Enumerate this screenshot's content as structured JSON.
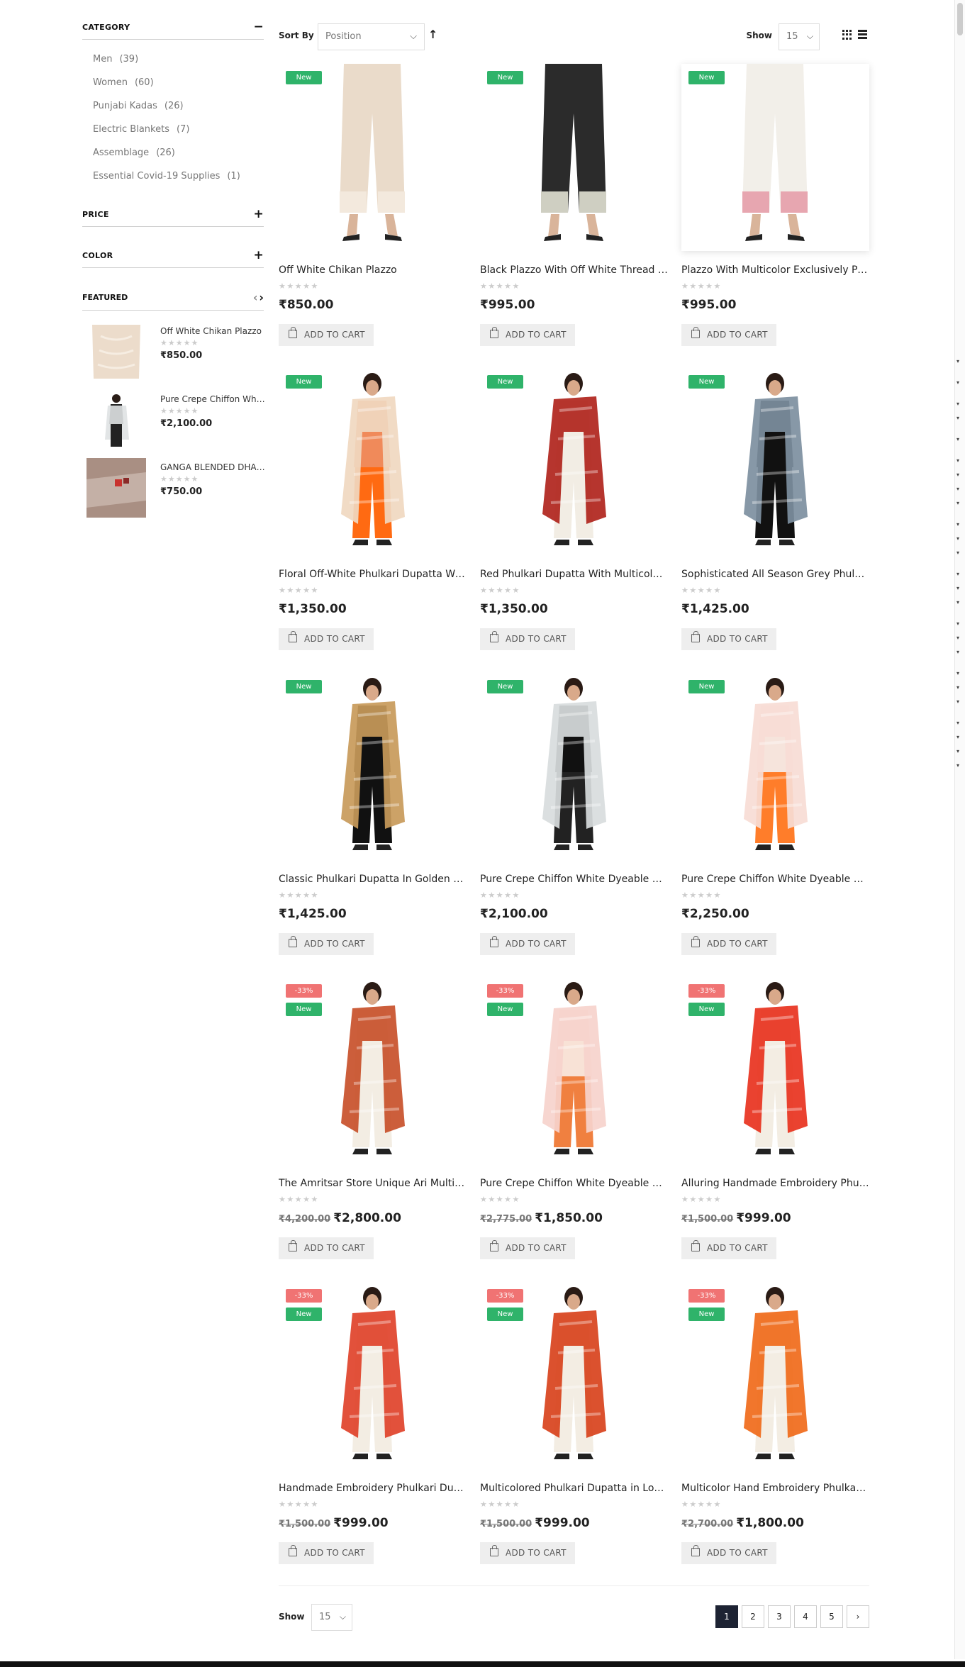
{
  "sidebar": {
    "category_title": "CATEGORY",
    "category_toggle": "−",
    "categories": [
      {
        "label": "Men",
        "count": "(39)"
      },
      {
        "label": "Women",
        "count": "(60)"
      },
      {
        "label": "Punjabi Kadas",
        "count": "(26)"
      },
      {
        "label": "Electric Blankets",
        "count": "(7)"
      },
      {
        "label": "Assemblage",
        "count": "(26)"
      },
      {
        "label": "Essential Covid-19 Supplies",
        "count": "(1)"
      }
    ],
    "price_title": "PRICE",
    "color_title": "COLOR",
    "expand_toggle": "+",
    "featured_title": "FEATURED",
    "featured": [
      {
        "name": "Off White Chikan Plazzo",
        "stars": "★★★★★",
        "price": "₹850.00"
      },
      {
        "name": "Pure Crepe Chiffon White Dyeable Dupatta",
        "stars": "★★★★★",
        "price": "₹2,100.00"
      },
      {
        "name": "GANGA BLENDED DHARIWAL SHAWL",
        "stars": "★★★★★",
        "price": "₹750.00"
      }
    ]
  },
  "toolbar": {
    "sort_label": "Sort By",
    "sort_value": "Position",
    "sort_dir": "🠕",
    "show_label": "Show",
    "show_value": "15"
  },
  "products": [
    {
      "name": "Off White Chikan Plazzo",
      "price": "₹850.00",
      "old_price": "",
      "new": "New",
      "discount": "",
      "stars": "★★★★★",
      "cart": "ADD TO CART"
    },
    {
      "name": "Black Plazzo With Off White Thread Work",
      "price": "₹995.00",
      "old_price": "",
      "new": "New",
      "discount": "",
      "stars": "★★★★★",
      "cart": "ADD TO CART"
    },
    {
      "name": "Plazzo With Multicolor Exclusively Printed",
      "price": "₹995.00",
      "old_price": "",
      "new": "New",
      "discount": "",
      "stars": "★★★★★",
      "cart": "ADD TO CART"
    },
    {
      "name": "Floral Off-White Phulkari Dupatta With Thread Work",
      "price": "₹1,350.00",
      "old_price": "",
      "new": "New",
      "discount": "",
      "stars": "★★★★★",
      "cart": "ADD TO CART"
    },
    {
      "name": "Red Phulkari Dupatta With Multicolor Embroidery",
      "price": "₹1,350.00",
      "old_price": "",
      "new": "New",
      "discount": "",
      "stars": "★★★★★",
      "cart": "ADD TO CART"
    },
    {
      "name": "Sophisticated All Season Grey Phulkari Dupatta",
      "price": "₹1,425.00",
      "old_price": "",
      "new": "New",
      "discount": "",
      "stars": "★★★★★",
      "cart": "ADD TO CART"
    },
    {
      "name": "Classic Phulkari Dupatta In Golden Embroidery",
      "price": "₹1,425.00",
      "old_price": "",
      "new": "New",
      "discount": "",
      "stars": "★★★★★",
      "cart": "ADD TO CART"
    },
    {
      "name": "Pure Crepe Chiffon White Dyeable Dupatta",
      "price": "₹2,100.00",
      "old_price": "",
      "new": "New",
      "discount": "",
      "stars": "★★★★★",
      "cart": "ADD TO CART"
    },
    {
      "name": "Pure Crepe Chiffon White Dyeable Dupatta",
      "price": "₹2,250.00",
      "old_price": "",
      "new": "New",
      "discount": "",
      "stars": "★★★★★",
      "cart": "ADD TO CART"
    },
    {
      "name": "The Amritsar Store Unique Ari Multicolor Dupatta",
      "price": "₹2,800.00",
      "old_price": "₹4,200.00",
      "new": "New",
      "discount": "-33%",
      "stars": "★★★★★",
      "cart": "ADD TO CART"
    },
    {
      "name": "Pure Crepe Chiffon White Dyeable Dupatta",
      "price": "₹1,850.00",
      "old_price": "₹2,775.00",
      "new": "New",
      "discount": "-33%",
      "stars": "★★★★★",
      "cart": "ADD TO CART"
    },
    {
      "name": "Alluring Handmade Embroidery Phulkari Dupatta",
      "price": "₹999.00",
      "old_price": "₹1,500.00",
      "new": "New",
      "discount": "-33%",
      "stars": "★★★★★",
      "cart": "ADD TO CART"
    },
    {
      "name": "Handmade Embroidery Phulkari Dupatta",
      "price": "₹999.00",
      "old_price": "₹1,500.00",
      "new": "New",
      "discount": "-33%",
      "stars": "★★★★★",
      "cart": "ADD TO CART"
    },
    {
      "name": "Multicolored Phulkari Dupatta in Lovely Colors",
      "price": "₹999.00",
      "old_price": "₹1,500.00",
      "new": "New",
      "discount": "-33%",
      "stars": "★★★★★",
      "cart": "ADD TO CART"
    },
    {
      "name": "Multicolor Hand Embroidery Phulkari Dupatta",
      "price": "₹1,800.00",
      "old_price": "₹2,700.00",
      "new": "New",
      "discount": "-33%",
      "stars": "★★★★★",
      "cart": "ADD TO CART"
    }
  ],
  "bottom": {
    "show_label": "Show",
    "show_value": "15",
    "pages": [
      "1",
      "2",
      "3",
      "4",
      "5"
    ],
    "next": "›"
  },
  "colors": {
    "new_badge": "#2fb36a",
    "discount_badge": "#f07373",
    "active_page": "#1d2333"
  }
}
